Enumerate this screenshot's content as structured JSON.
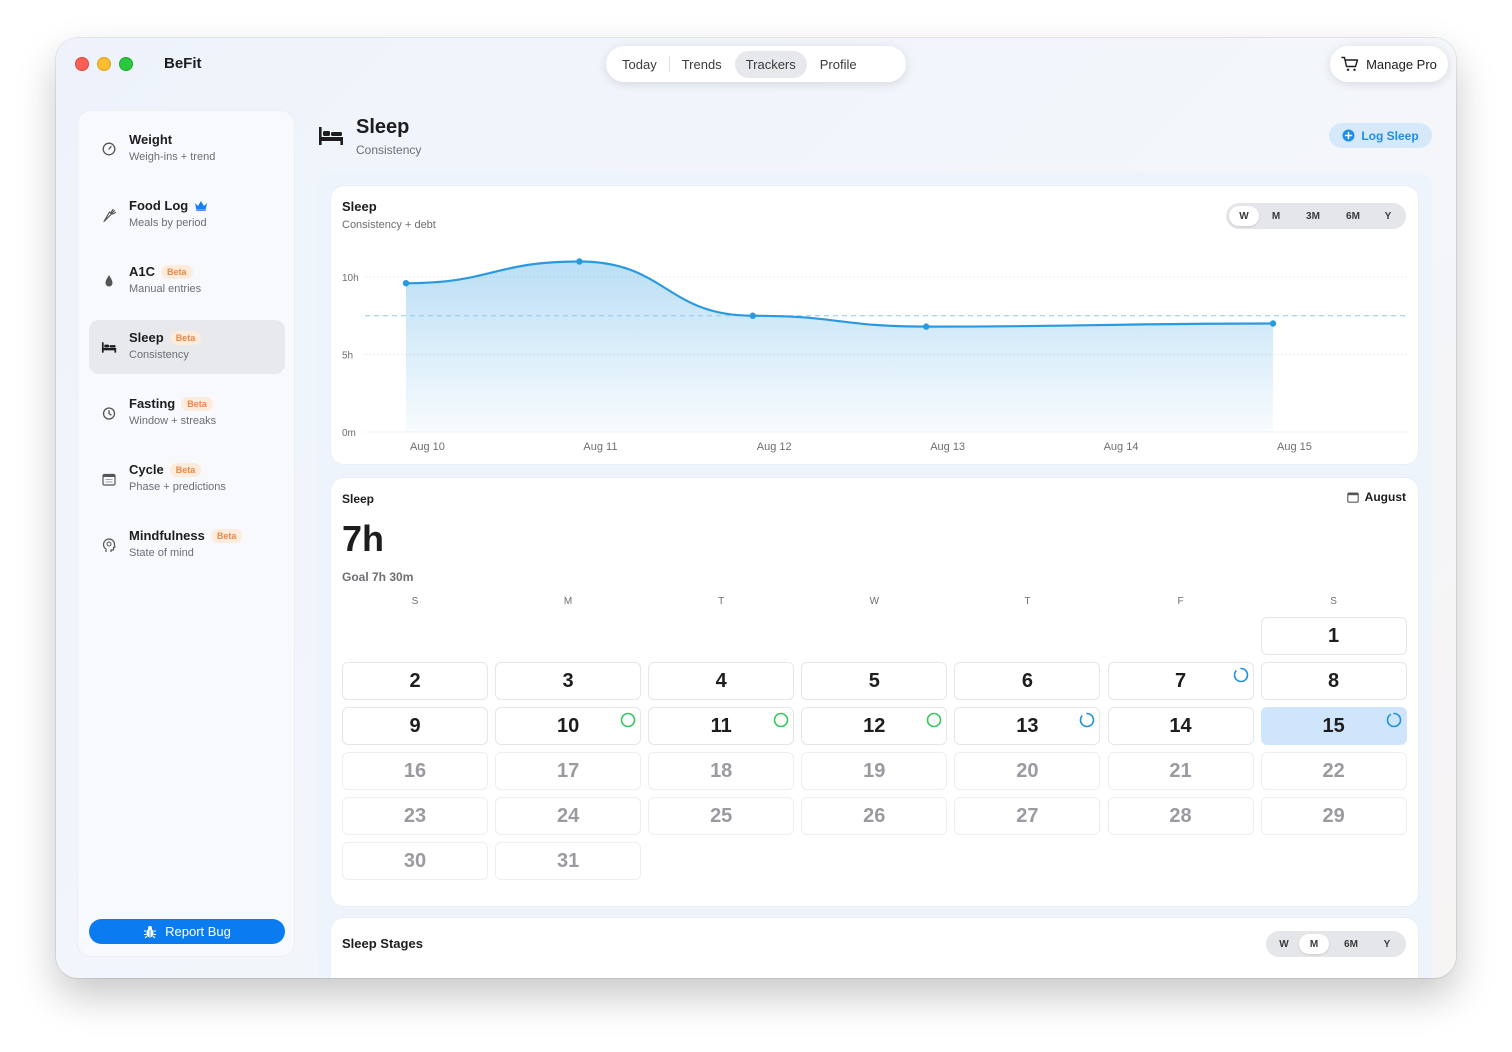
{
  "app": {
    "title": "BeFit"
  },
  "tabs": [
    {
      "label": "Today",
      "active": false
    },
    {
      "label": "Trends",
      "active": false
    },
    {
      "label": "Trackers",
      "active": true
    },
    {
      "label": "Profile",
      "active": false
    }
  ],
  "manage_pro": {
    "label": "Manage Pro"
  },
  "sidebar": {
    "items": [
      {
        "title": "Weight",
        "sub": "Weigh-ins + trend",
        "icon": "gauge-icon",
        "beta": "",
        "crown": false
      },
      {
        "title": "Food Log",
        "sub": "Meals by period",
        "icon": "carrot-icon",
        "beta": "",
        "crown": true
      },
      {
        "title": "A1C",
        "sub": "Manual entries",
        "icon": "drop-icon",
        "beta": "Beta",
        "crown": false
      },
      {
        "title": "Sleep",
        "sub": "Consistency",
        "icon": "bed-icon",
        "beta": "Beta",
        "crown": false,
        "active": true
      },
      {
        "title": "Fasting",
        "sub": "Window + streaks",
        "icon": "timer-icon",
        "beta": "Beta",
        "crown": false
      },
      {
        "title": "Cycle",
        "sub": "Phase + predictions",
        "icon": "calendar-icon",
        "beta": "Beta",
        "crown": false
      },
      {
        "title": "Mindfulness",
        "sub": "State of mind",
        "icon": "head-icon",
        "beta": "Beta",
        "crown": false
      }
    ],
    "report_bug": "Report Bug"
  },
  "header": {
    "title": "Sleep",
    "subtitle": "Consistency",
    "action": "Log Sleep"
  },
  "chart_card": {
    "title": "Sleep",
    "subtitle": "Consistency + debt",
    "ranges": [
      {
        "label": "W",
        "active": true
      },
      {
        "label": "M",
        "active": false
      },
      {
        "label": "3M",
        "active": false
      },
      {
        "label": "6M",
        "active": false
      },
      {
        "label": "Y",
        "active": false
      }
    ]
  },
  "chart_data": {
    "type": "area",
    "x": [
      "Aug 10",
      "Aug 11",
      "Aug 12",
      "Aug 13",
      "Aug 14",
      "Aug 15"
    ],
    "series": [
      {
        "values": [
          9.6,
          11.0,
          7.5,
          6.8,
          null,
          7.0
        ]
      }
    ],
    "goal": 7.5,
    "y_ticks": [
      "0m",
      "5h",
      "10h"
    ],
    "ylim": [
      0,
      12
    ],
    "grid": true,
    "accent": "#2a9ae0"
  },
  "calendar": {
    "title": "Sleep",
    "value": "7h",
    "goal": "Goal 7h 30m",
    "month": "August",
    "weekdays": [
      "S",
      "M",
      "T",
      "W",
      "T",
      "F",
      "S"
    ],
    "start_offset": 6,
    "days": [
      {
        "d": "1"
      },
      {
        "d": "2"
      },
      {
        "d": "3"
      },
      {
        "d": "4"
      },
      {
        "d": "5"
      },
      {
        "d": "6"
      },
      {
        "d": "7",
        "ring": "blue",
        "progress": 0.85
      },
      {
        "d": "8"
      },
      {
        "d": "9"
      },
      {
        "d": "10",
        "ring": "green",
        "progress": 1.0
      },
      {
        "d": "11",
        "ring": "green",
        "progress": 1.0
      },
      {
        "d": "12",
        "ring": "green",
        "progress": 1.0
      },
      {
        "d": "13",
        "ring": "blue",
        "progress": 0.85
      },
      {
        "d": "14"
      },
      {
        "d": "15",
        "ring": "blue",
        "progress": 0.9,
        "today": true
      },
      {
        "d": "16",
        "future": true
      },
      {
        "d": "17",
        "future": true
      },
      {
        "d": "18",
        "future": true
      },
      {
        "d": "19",
        "future": true
      },
      {
        "d": "20",
        "future": true
      },
      {
        "d": "21",
        "future": true
      },
      {
        "d": "22",
        "future": true
      },
      {
        "d": "23",
        "future": true
      },
      {
        "d": "24",
        "future": true
      },
      {
        "d": "25",
        "future": true
      },
      {
        "d": "26",
        "future": true
      },
      {
        "d": "27",
        "future": true
      },
      {
        "d": "28",
        "future": true
      },
      {
        "d": "29",
        "future": true
      },
      {
        "d": "30",
        "future": true
      },
      {
        "d": "31",
        "future": true
      }
    ],
    "colors": {
      "green": "#34c759",
      "blue": "#1e90e0"
    }
  },
  "stages_card": {
    "title": "Sleep Stages",
    "ranges": [
      {
        "label": "W",
        "active": false
      },
      {
        "label": "M",
        "active": true
      },
      {
        "label": "6M",
        "active": false
      },
      {
        "label": "Y",
        "active": false
      }
    ]
  }
}
